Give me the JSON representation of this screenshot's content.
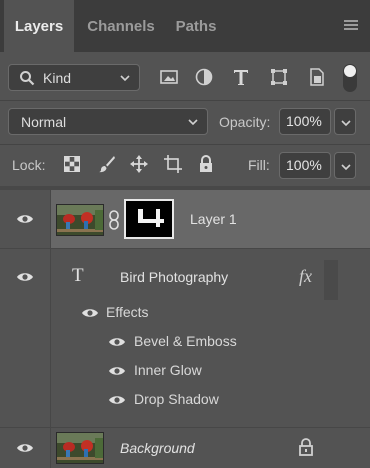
{
  "tabs": [
    {
      "label": "Layers",
      "active": true
    },
    {
      "label": "Channels",
      "active": false
    },
    {
      "label": "Paths",
      "active": false
    }
  ],
  "filter": {
    "kind_label": "Kind",
    "icons": [
      "image-filter-icon",
      "adjustment-filter-icon",
      "type-filter-icon",
      "shape-filter-icon",
      "smart-object-filter-icon"
    ]
  },
  "blend": {
    "mode": "Normal",
    "opacity_label": "Opacity:",
    "opacity_value": "100%"
  },
  "lock": {
    "label": "Lock:",
    "fill_label": "Fill:",
    "fill_value": "100%"
  },
  "layers": {
    "layer1_name": "Layer 1",
    "text_layer_name": "Bird Photography",
    "fx_label": "fx",
    "type_glyph": "T",
    "effects_label": "Effects",
    "effects": [
      "Bevel & Emboss",
      "Inner Glow",
      "Drop Shadow"
    ],
    "background_name": "Background",
    "mask_text": "4"
  },
  "colors": {
    "panel_bg": "#535353",
    "tabbar_bg": "#3c3c3c",
    "selected_row": "#686868"
  }
}
